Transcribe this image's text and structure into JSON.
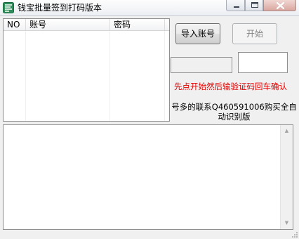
{
  "window": {
    "title": "钱宝批量签到打码版本",
    "controls": [
      "minimize-icon",
      "maximize-icon",
      "close-icon"
    ]
  },
  "table": {
    "columns": [
      "NO",
      "账号",
      "密码"
    ],
    "rows": []
  },
  "buttons": {
    "import": "导入账号",
    "start": "开始"
  },
  "inputs": {
    "status_value": "",
    "captcha_value": ""
  },
  "hint": "先点开始然后输验证码回车确认",
  "contact": "号多的联系Q460591006购买全自动识别版",
  "log": {
    "text": ""
  },
  "colors": {
    "hint": "#e00000",
    "background": "#f0f0f0"
  }
}
